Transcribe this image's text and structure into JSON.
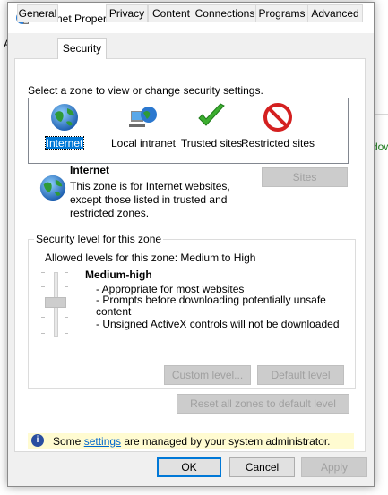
{
  "background": {
    "left_letter": "A",
    "right_text": "dow"
  },
  "window": {
    "title": "Internet Properties",
    "help_glyph": "?",
    "close_glyph": "✕"
  },
  "tabs": [
    {
      "label": "General"
    },
    {
      "label": "Security",
      "active": true
    },
    {
      "label": "Privacy"
    },
    {
      "label": "Content"
    },
    {
      "label": "Connections"
    },
    {
      "label": "Programs"
    },
    {
      "label": "Advanced"
    }
  ],
  "security": {
    "zone_prompt": "Select a zone to view or change security settings.",
    "zones": [
      {
        "label": "Internet",
        "icon": "globe-icon",
        "selected": true
      },
      {
        "label": "Local intranet",
        "icon": "intranet-icon"
      },
      {
        "label": "Trusted sites",
        "icon": "checkmark-icon"
      },
      {
        "label": "Restricted sites",
        "icon": "restricted-icon"
      }
    ],
    "zone_info": {
      "title": "Internet",
      "description": "This zone is for Internet websites, except those listed in trusted and restricted zones.",
      "sites_button": "Sites"
    },
    "level_group": {
      "legend": "Security level for this zone",
      "allowed_levels": "Allowed levels for this zone: Medium to High",
      "level_name": "Medium-high",
      "bullets": [
        "- Appropriate for most websites",
        "- Prompts before downloading potentially unsafe content",
        "- Unsigned ActiveX controls will not be downloaded"
      ],
      "slider_level": 3,
      "slider_levels": 5,
      "custom_level_button": "Custom level...",
      "default_level_button": "Default level"
    },
    "reset_all_button": "Reset all zones to default level",
    "admin_notice": {
      "prefix": "Some ",
      "link": "settings",
      "suffix": " are managed by your system administrator."
    }
  },
  "footer": {
    "ok": "OK",
    "cancel": "Cancel",
    "apply": "Apply"
  },
  "colors": {
    "accent": "#0078d7",
    "info_bg": "#fffbd1",
    "link": "#0066cc"
  }
}
